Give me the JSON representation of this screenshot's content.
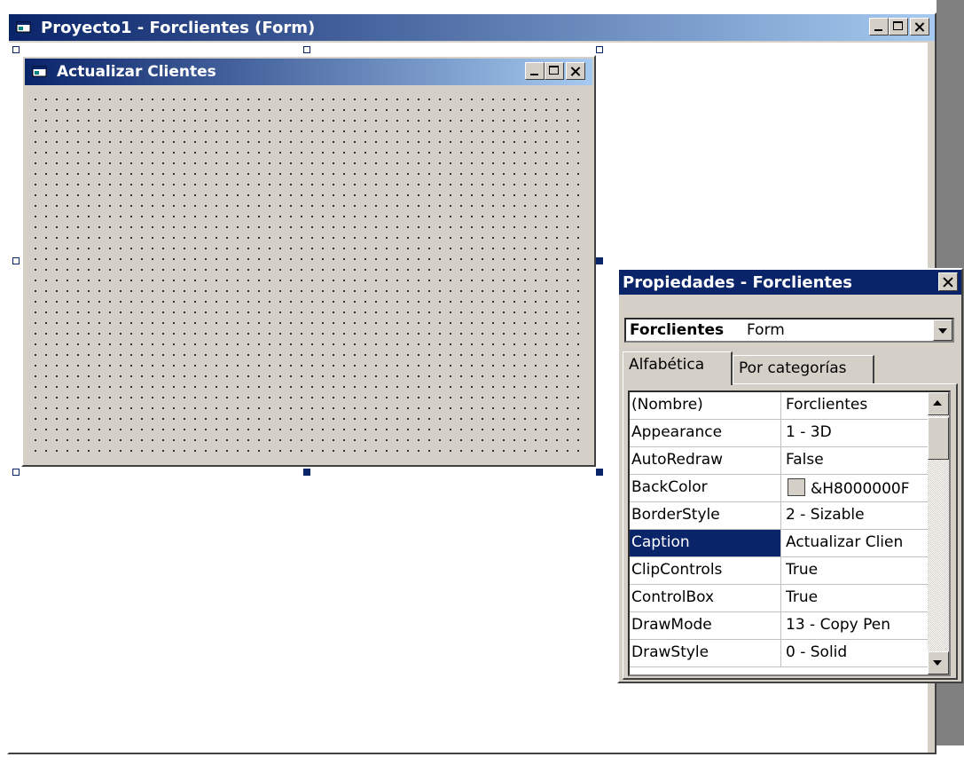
{
  "outer_window": {
    "title": "Proyecto1 - Forclientes (Form)"
  },
  "inner_form": {
    "title": "Actualizar Clientes"
  },
  "properties": {
    "title": "Propiedades - Forclientes",
    "object_name": "Forclientes",
    "object_type": "Form",
    "tabs": [
      "Alfabética",
      "Por categorías"
    ],
    "active_tab": "Alfabética",
    "rows": [
      {
        "name": "(Nombre)",
        "value": "Forclientes"
      },
      {
        "name": "Appearance",
        "value": "1 - 3D"
      },
      {
        "name": "AutoRedraw",
        "value": "False"
      },
      {
        "name": "BackColor",
        "value": "&H8000000F"
      },
      {
        "name": "BorderStyle",
        "value": "2 - Sizable"
      },
      {
        "name": "Caption",
        "value": "Actualizar Clien"
      },
      {
        "name": "ClipControls",
        "value": "True"
      },
      {
        "name": "ControlBox",
        "value": "True"
      },
      {
        "name": "DrawMode",
        "value": "13 - Copy Pen"
      },
      {
        "name": "DrawStyle",
        "value": "0 - Solid"
      }
    ],
    "selected_row": "Caption"
  },
  "colors": {
    "titlebar_active": "#0a246a",
    "face": "#d4d0c8",
    "selection": "#0a246a"
  }
}
